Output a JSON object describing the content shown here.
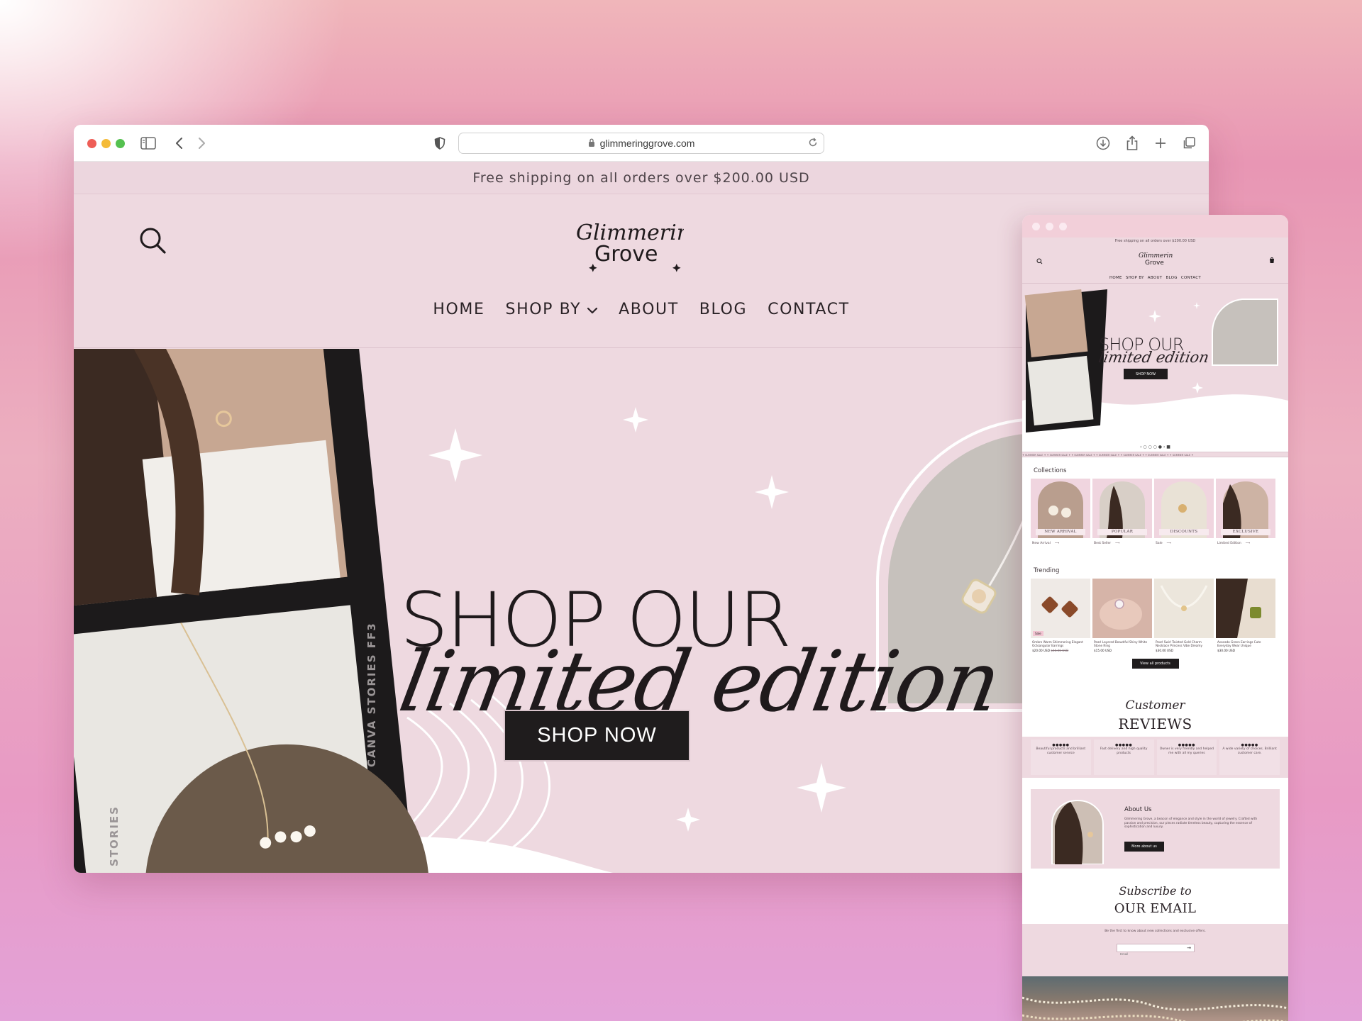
{
  "browser": {
    "url": "glimmeringgrove.com"
  },
  "store": {
    "announcement": "Free shipping on all orders over $200.00 USD",
    "logo_top": "Glimmering",
    "logo_bottom": "Grove",
    "nav": [
      {
        "label": "HOME"
      },
      {
        "label": "SHOP BY"
      },
      {
        "label": "ABOUT"
      },
      {
        "label": "BLOG"
      },
      {
        "label": "CONTACT"
      }
    ],
    "hero": {
      "headline": "SHOP OUR",
      "script": "limited edition",
      "button": "SHOP NOW",
      "film_text": "CANVA STORIES FF3",
      "film_text_2": "STORIES"
    }
  },
  "preview": {
    "announcement": "Free shipping on all orders over $200.00 USD",
    "logo_top": "Glimmering",
    "logo_bottom": "Grove",
    "nav": [
      "HOME",
      "SHOP BY",
      "ABOUT",
      "BLOG",
      "CONTACT"
    ],
    "hero": {
      "headline": "SHOP OUR",
      "script": "limited edition",
      "button": "SHOP NOW"
    },
    "slider_dots": "‹ ○ ○ ○ ● › ■",
    "marquee": "✦ SUMMER SALE ✦ ✦ SUMMER SALE ✦ ✦ SUMMER SALE ✦ ✦ SUMMER SALE ✦ ✦ SUMMER SALE ✦ ✦ SUMMER SALE ✦ ✦ SUMMER SALE ✦",
    "collections": {
      "title": "Collections",
      "items": [
        {
          "label": "NEW ARRIVAL",
          "link": "New Arrival"
        },
        {
          "label": "POPULAR",
          "link": "Best Seller"
        },
        {
          "label": "DISCOUNTS",
          "link": "Sale"
        },
        {
          "label": "EXCLUSIVE",
          "link": "Limited Edition"
        }
      ]
    },
    "trending": {
      "title": "Trending",
      "items": [
        {
          "title": "Ombre Warm Shimmering Elegant Octoangular Earrings",
          "price": "$20.00 USD",
          "old_price": "$40.00 USD",
          "badge": "Sale"
        },
        {
          "title": "Pearl Layered Beautiful Shiny White Stone Ring",
          "price": "$15.00 USD"
        },
        {
          "title": "Pearl Swirl Twisted Gold Charm Necklace Princess Vibe Dreamy",
          "price": "$30.00 USD"
        },
        {
          "title": "Avocado Green Earrings Cute Everyday Wear Unique",
          "price": "$30.00 USD"
        }
      ],
      "button": "View all products"
    },
    "reviews": {
      "script": "Customer",
      "title": "REVIEWS",
      "items": [
        {
          "stars": "●●●●●",
          "text": "Beautiful products and brilliant customer service"
        },
        {
          "stars": "●●●●●",
          "text": "Fast delivery and high quality products"
        },
        {
          "stars": "●●●●●",
          "text": "Owner is very friendly and helped me with all my queries"
        },
        {
          "stars": "●●●●●",
          "text": "A wide variety of choices. Brilliant customer care."
        }
      ]
    },
    "about": {
      "title": "About Us",
      "text": "Glimmering Grove, a beacon of elegance and style in the world of jewelry. Crafted with passion and precision, our pieces radiate timeless beauty, capturing the essence of sophistication and luxury.",
      "button": "More about us"
    },
    "subscribe": {
      "script": "Subscribe to",
      "title": "OUR EMAIL",
      "text": "Be the first to know about new collections and exclusive offers.",
      "placeholder": "Email"
    }
  },
  "colors": {
    "accent_pink": "#eed9e0",
    "dark": "#1f1c1d"
  }
}
